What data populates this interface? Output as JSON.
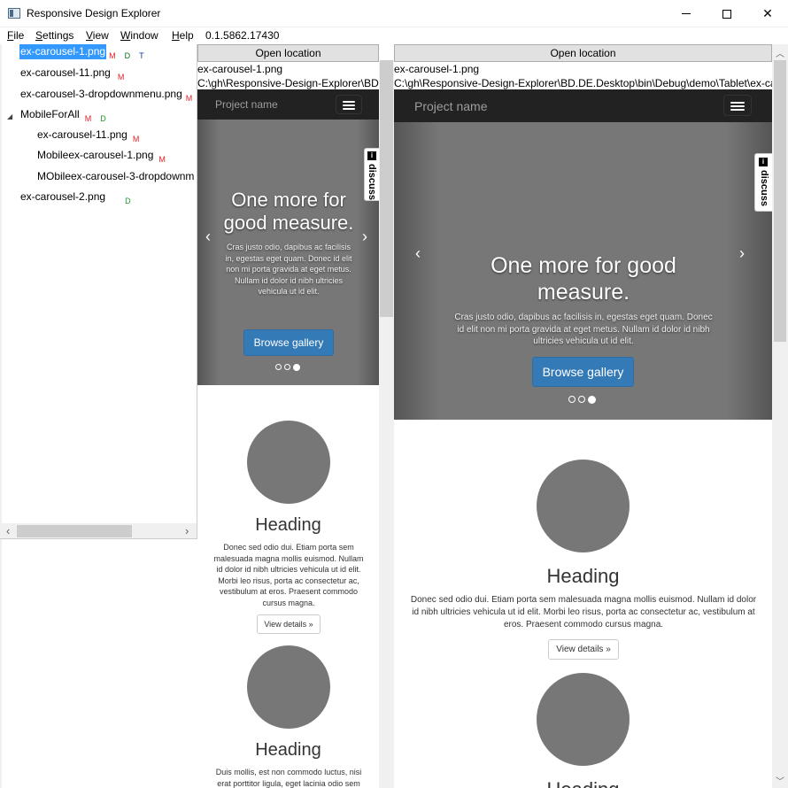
{
  "window": {
    "title": "Responsive Design Explorer"
  },
  "menu": {
    "file": "File",
    "settings": "Settings",
    "view": "View",
    "window": "Window",
    "help": "Help",
    "version": "0.1.5862.17430"
  },
  "tree": {
    "items": [
      {
        "label": "ex-carousel-1.png",
        "badges": [
          "M",
          "D",
          "T"
        ]
      },
      {
        "label": "ex-carousel-11.png",
        "badges": [
          "M"
        ]
      },
      {
        "label": "ex-carousel-3-dropdownmenu.png",
        "badges": [
          "M"
        ]
      },
      {
        "label": "MobileForAll",
        "badges": [
          "M",
          "D"
        ]
      },
      {
        "label": "ex-carousel-11.png",
        "badges": [
          "M"
        ]
      },
      {
        "label": "Mobileex-carousel-1.png",
        "badges": [
          "M"
        ]
      },
      {
        "label": "MObileex-carousel-3-dropdownm",
        "badges": []
      },
      {
        "label": "ex-carousel-2.png",
        "badges": [
          "D"
        ]
      }
    ]
  },
  "preview_left": {
    "open_label": "Open location",
    "filename": "ex-carousel-1.png",
    "path": "C:\\gh\\Responsive-Design-Explorer\\BD.",
    "brand": "Project name",
    "headline": "One more for good measure.",
    "caption": "Cras justo odio, dapibus ac facilisis in, egestas eget quam. Donec id elit non mi porta gravida at eget metus. Nullam id dolor id nibh ultricies vehicula ut id elit.",
    "browse": "Browse gallery",
    "discuss": "discuss",
    "discuss_icon": "i",
    "heading1": "Heading",
    "text1": "Donec sed odio dui. Etiam porta sem malesuada magna mollis euismod. Nullam id dolor id nibh ultricies vehicula ut id elit. Morbi leo risus, porta ac consectetur ac, vestibulum at eros. Praesent commodo cursus magna.",
    "details": "View details »",
    "heading2": "Heading",
    "text2": "Duis mollis, est non commodo luctus, nisi erat porttitor ligula, eget lacinia odio sem"
  },
  "preview_right": {
    "open_label": "Open location",
    "filename": "ex-carousel-1.png",
    "path": "C:\\gh\\Responsive-Design-Explorer\\BD.DE.Desktop\\bin\\Debug\\demo\\Tablet\\ex-ca",
    "brand": "Project name",
    "headline": "One more for good measure.",
    "caption": "Cras justo odio, dapibus ac facilisis in, egestas eget quam. Donec id elit non mi porta gravida at eget metus. Nullam id dolor id nibh ultricies vehicula ut id elit.",
    "browse": "Browse gallery",
    "discuss": "discuss",
    "discuss_icon": "i",
    "heading1": "Heading",
    "text1": "Donec sed odio dui. Etiam porta sem malesuada magna mollis euismod. Nullam id dolor id nibh ultricies vehicula ut id elit. Morbi leo risus, porta ac consectetur ac, vestibulum at eros. Praesent commodo cursus magna.",
    "details": "View details »",
    "heading2": "Heading"
  },
  "colors": {
    "selection": "#3399ff",
    "navbar": "#222222",
    "primary_button": "#337ab7",
    "badge_m": "#e0202a",
    "badge_d": "#1a9a2c",
    "badge_t": "#1a3adc"
  }
}
